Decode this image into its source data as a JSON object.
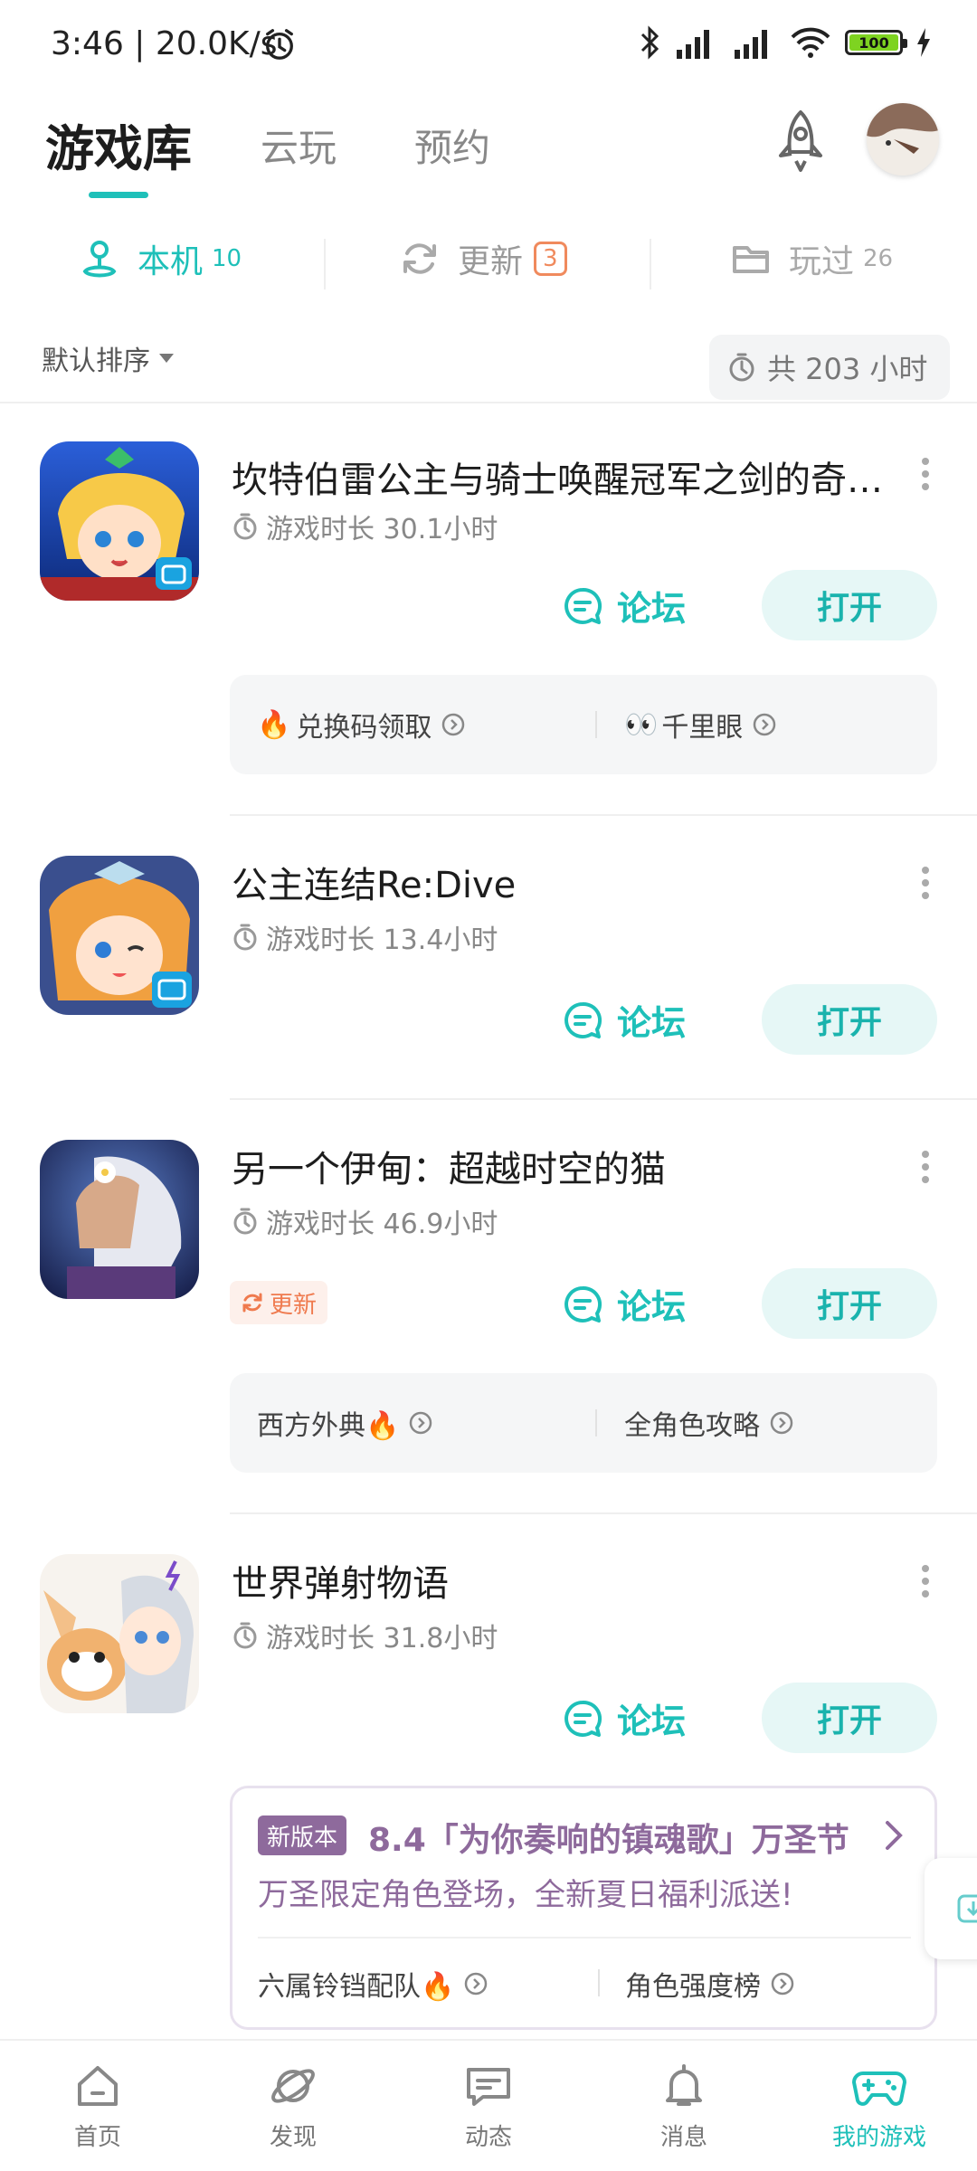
{
  "status_bar": {
    "time": "3:46 | 20.0K/s",
    "battery": "100"
  },
  "header": {
    "tabs": [
      {
        "label": "游戏库",
        "active": true
      },
      {
        "label": "云玩",
        "active": false
      },
      {
        "label": "预约",
        "active": false
      }
    ],
    "icons": [
      "rocket-icon",
      "avatar"
    ]
  },
  "subtabs": [
    {
      "label": "本机",
      "count": "10",
      "icon": "local-icon",
      "active": true
    },
    {
      "label": "更新",
      "count": "3",
      "icon": "refresh-icon",
      "active": false
    },
    {
      "label": "玩过",
      "count": "26",
      "icon": "folder-icon",
      "active": false
    }
  ],
  "sort": {
    "label": "默认排序",
    "total": "共 203 小时"
  },
  "games": [
    {
      "title": "坎特伯雷公主与骑士唤醒冠军之剑的奇幻冒险",
      "playtime": "游戏时长 30.1小时",
      "forum": "论坛",
      "open": "打开",
      "links": [
        {
          "label": "兑换码领取",
          "prefix": "🔥"
        },
        {
          "label": "千里眼",
          "prefix": "👀"
        }
      ]
    },
    {
      "title": "公主连结Re:Dive",
      "playtime": "游戏时长 13.4小时",
      "forum": "论坛",
      "open": "打开"
    },
    {
      "title": "另一个伊甸：超越时空的猫",
      "playtime": "游戏时长 46.9小时",
      "update_tag": "更新",
      "forum": "论坛",
      "open": "打开",
      "links": [
        {
          "label": "西方外典🔥"
        },
        {
          "label": "全角色攻略"
        }
      ]
    },
    {
      "title": "世界弹射物语",
      "playtime": "游戏时长 31.8小时",
      "forum": "论坛",
      "open": "打开",
      "news": {
        "tag": "新版本",
        "title": "8.4「为你奏响的镇魂歌」万圣节",
        "desc": "万圣限定角色登场，全新夏日福利派送!",
        "links": [
          {
            "label": "六属铃铛配队🔥"
          },
          {
            "label": "角色强度榜"
          }
        ]
      }
    }
  ],
  "bottom_nav": [
    {
      "label": "首页",
      "icon": "home-icon"
    },
    {
      "label": "发现",
      "icon": "planet-icon"
    },
    {
      "label": "动态",
      "icon": "chat-icon"
    },
    {
      "label": "消息",
      "icon": "bell-icon"
    },
    {
      "label": "我的游戏",
      "icon": "gamepad-icon",
      "active": true
    }
  ],
  "colors": {
    "accent": "#1ec0b9",
    "update": "#ef7a4e",
    "news": "#8e6a9c"
  }
}
